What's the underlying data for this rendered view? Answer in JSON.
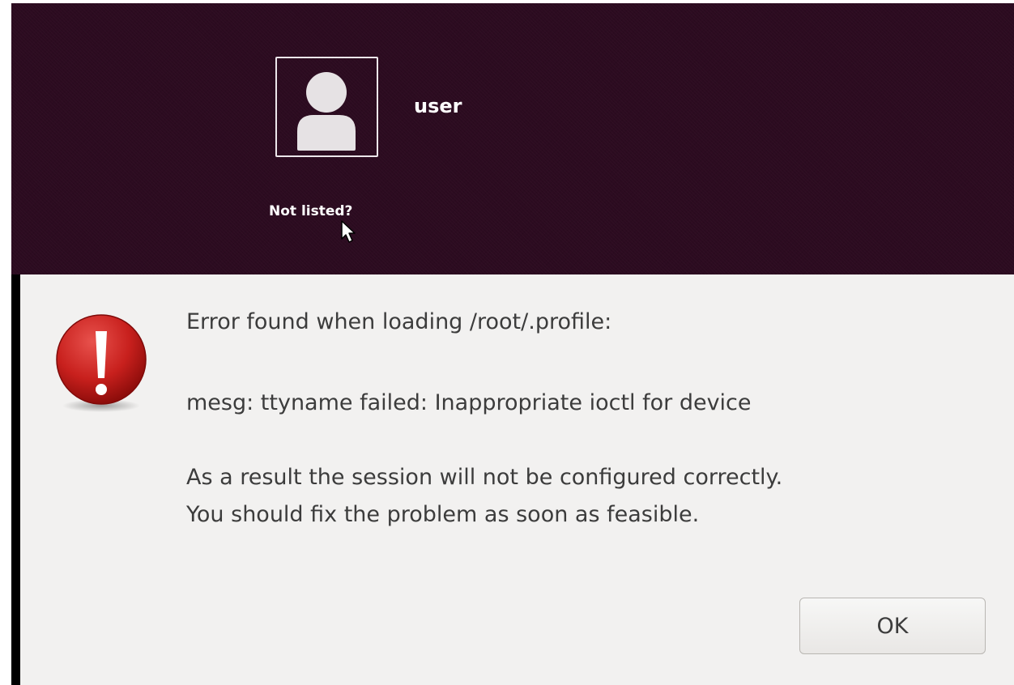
{
  "greeter": {
    "user_name": "user",
    "not_listed_label": "Not listed?",
    "avatar_icon": "user-avatar-icon",
    "background_color": "#2c0b20"
  },
  "dialog": {
    "icon": "error-exclamation-icon",
    "message_line_1": "Error found when loading /root/.profile:",
    "message_line_2": "mesg: ttyname failed: Inappropriate ioctl for device",
    "message_line_3": "As a result the session will not be configured correctly.",
    "message_line_4": "You should fix the problem as soon as feasible.",
    "ok_label": "OK",
    "background_color": "#f2f1f0"
  }
}
